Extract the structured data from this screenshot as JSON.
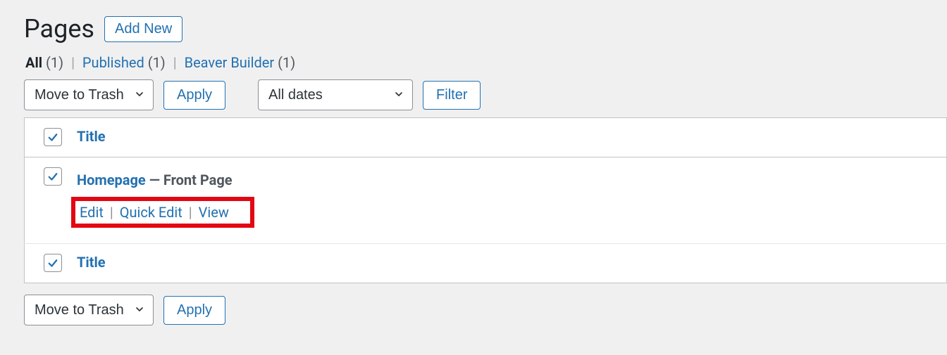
{
  "heading": "Pages",
  "add_new": "Add New",
  "filters": {
    "all_label": "All",
    "all_count": "(1)",
    "published_label": "Published",
    "published_count": "(1)",
    "bb_label": "Beaver Builder",
    "bb_count": "(1)"
  },
  "bulk": {
    "action_selected": "Move to Trash",
    "apply": "Apply"
  },
  "date_filter": {
    "selected": "All dates",
    "button": "Filter"
  },
  "columns": {
    "title": "Title"
  },
  "rows": [
    {
      "title": "Homepage",
      "suffix": " — Front Page",
      "actions": {
        "edit": "Edit",
        "quick_edit": "Quick Edit",
        "view": "View"
      }
    }
  ]
}
